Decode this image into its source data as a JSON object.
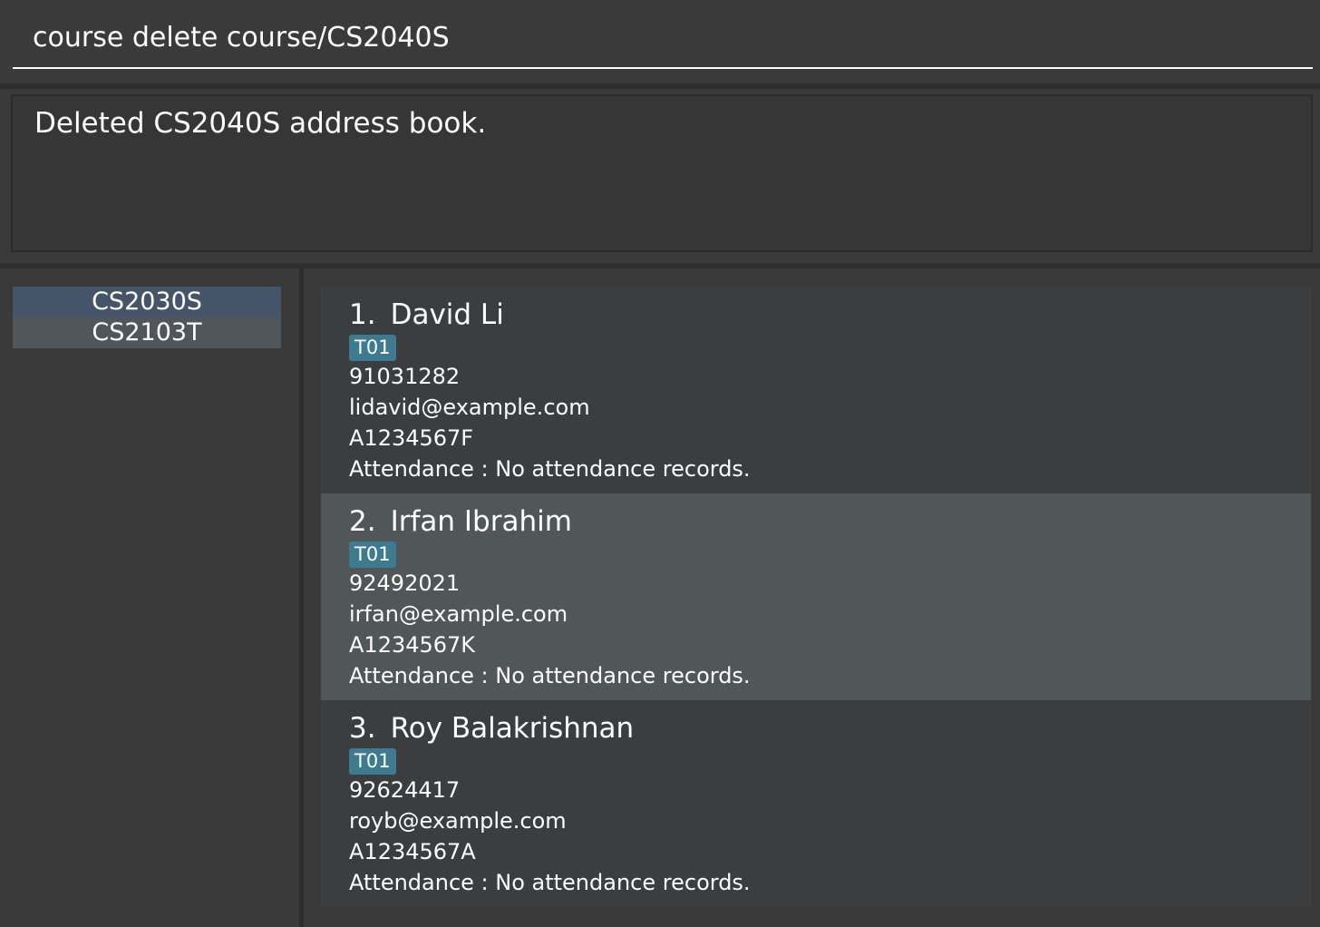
{
  "command_box": {
    "value": "course delete course/CS2040S"
  },
  "result_display": {
    "message": "Deleted CS2040S address book."
  },
  "course_list": {
    "items": [
      {
        "label": "CS2030S",
        "selected": true
      },
      {
        "label": "CS2103T",
        "selected": false
      }
    ]
  },
  "person_list": {
    "persons": [
      {
        "index": "1.",
        "name": "David Li",
        "tag": "T01",
        "phone": "91031282",
        "email": "lidavid@example.com",
        "student_id": "A1234567F",
        "attendance": "Attendance : No attendance records."
      },
      {
        "index": "2.",
        "name": "Irfan Ibrahim",
        "tag": "T01",
        "phone": "92492021",
        "email": "irfan@example.com",
        "student_id": "A1234567K",
        "attendance": "Attendance : No attendance records."
      },
      {
        "index": "3.",
        "name": "Roy Balakrishnan",
        "tag": "T01",
        "phone": "92624417",
        "email": "royb@example.com",
        "student_id": "A1234567A",
        "attendance": "Attendance : No attendance records."
      }
    ]
  },
  "colors": {
    "background": "#3a3a3a",
    "tag": "#3e7b91",
    "selected_course": "#455468",
    "highlighted_card": "#515659"
  }
}
